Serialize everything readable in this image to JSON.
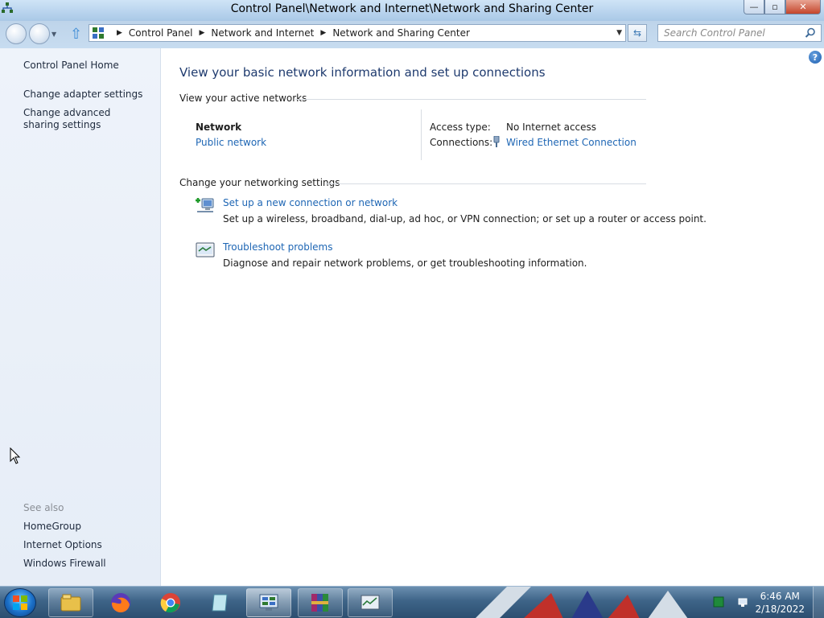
{
  "window": {
    "title": "Control Panel\\Network and Internet\\Network and Sharing Center",
    "minimize": "—",
    "restore": "▫",
    "close": "✕"
  },
  "nav": {
    "breadcrumbs": [
      "Control Panel",
      "Network and Internet",
      "Network and Sharing Center"
    ],
    "search_placeholder": "Search Control Panel"
  },
  "sidebar": {
    "items": [
      {
        "label": "Control Panel Home"
      },
      {
        "label": "Change adapter settings"
      },
      {
        "label": "Change advanced sharing settings"
      }
    ],
    "see_also_label": "See also",
    "see_also": [
      {
        "label": "HomeGroup"
      },
      {
        "label": "Internet Options"
      },
      {
        "label": "Windows Firewall"
      }
    ]
  },
  "main": {
    "title": "View your basic network information and set up connections",
    "active_networks_heading": "View your active networks",
    "network": {
      "name": "Network",
      "type": "Public network",
      "access_type_label": "Access type:",
      "access_type_value": "No Internet access",
      "connections_label": "Connections:",
      "connections_value": "Wired Ethernet Connection"
    },
    "settings_heading": "Change your networking settings",
    "tasks": [
      {
        "link": "Set up a new connection or network",
        "desc": "Set up a wireless, broadband, dial-up, ad hoc, or VPN connection; or set up a router or access point.",
        "icon": "network-setup-icon"
      },
      {
        "link": "Troubleshoot problems",
        "desc": "Diagnose and repair network problems, or get troubleshooting information.",
        "icon": "troubleshoot-icon"
      }
    ]
  },
  "taskbar": {
    "items": [
      "file-explorer-icon",
      "firefox-icon",
      "chrome-icon",
      "notepad-icon",
      "control-panel-icon",
      "winrar-icon",
      "task-manager-icon"
    ],
    "time": "6:46 AM",
    "date": "2/18/2022"
  },
  "colors": {
    "link": "#1e66b4",
    "title": "#1e3a6e",
    "sidebar_bg": "#e6edf7",
    "taskbar": "#3e6488"
  }
}
